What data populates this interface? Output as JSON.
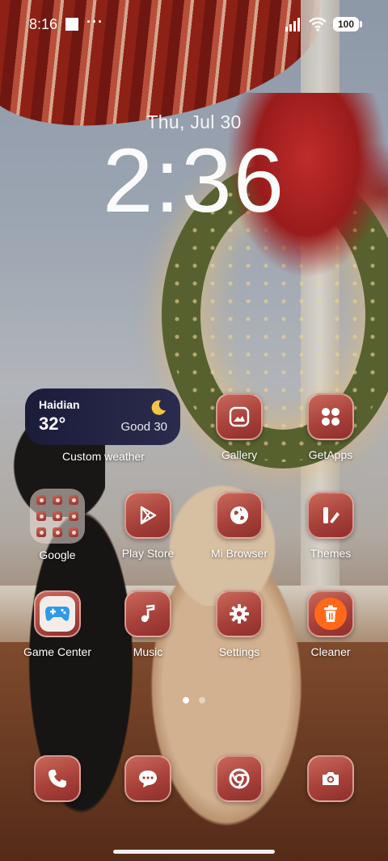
{
  "status_bar": {
    "time": "8:16",
    "extra": "···",
    "battery": "100"
  },
  "lockclock": {
    "date": "Thu, Jul 30",
    "time": "2:36"
  },
  "weather_widget": {
    "city": "Haidian",
    "temperature": "32°",
    "air_quality": "Good 30",
    "label": "Custom weather",
    "icon": "crescent-moon-icon"
  },
  "apps": {
    "gallery": {
      "label": "Gallery",
      "icon": "image-icon"
    },
    "getapps": {
      "label": "GetApps",
      "icon": "four-dots-icon"
    },
    "google": {
      "label": "Google",
      "icon": "folder-icon"
    },
    "play_store": {
      "label": "Play Store",
      "icon": "play-triangle-icon"
    },
    "mi_browser": {
      "label": "Mi Browser",
      "icon": "globe-icon"
    },
    "themes": {
      "label": "Themes",
      "icon": "themes-icon"
    },
    "game_center": {
      "label": "Game Center",
      "icon": "gamepad-icon"
    },
    "music": {
      "label": "Music",
      "icon": "music-note-icon"
    },
    "settings": {
      "label": "Settings",
      "icon": "gear-icon"
    },
    "cleaner": {
      "label": "Cleaner",
      "icon": "trash-icon"
    }
  },
  "dock": [
    {
      "name": "phone",
      "icon": "phone-icon"
    },
    {
      "name": "messages",
      "icon": "message-bubble-icon"
    },
    {
      "name": "chrome",
      "icon": "chrome-icon"
    },
    {
      "name": "camera",
      "icon": "camera-icon"
    }
  ],
  "page_indicator": {
    "total": 2,
    "active": 1
  },
  "colors": {
    "icon_tile": "#a8413a",
    "weather_bg": "#1b1c3a",
    "moon": "#f3c544",
    "cleaner": "#ff6a1a",
    "gamepad": "#2f9ae8"
  }
}
